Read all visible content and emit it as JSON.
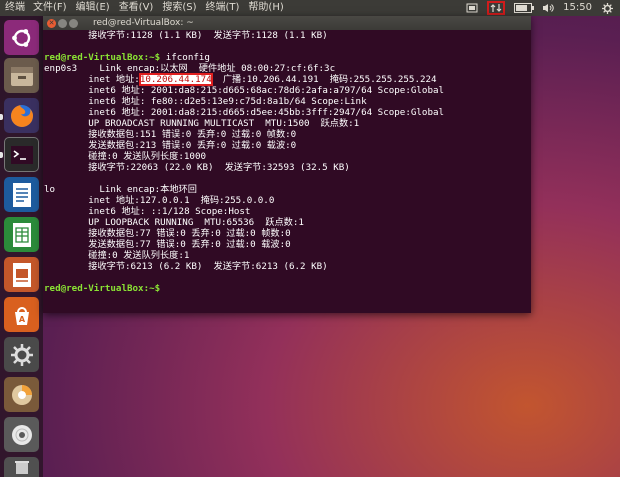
{
  "topbar": {
    "app_name": "终端",
    "menu": [
      "文件(F)",
      "编辑(E)",
      "查看(V)",
      "搜索(S)",
      "终端(T)",
      "帮助(H)"
    ],
    "clock": "15:50",
    "battery_level": 0.8,
    "highlight_color": "#d21c1c"
  },
  "launcher": {
    "icons": [
      "ubuntu-dash-icon",
      "files-icon",
      "firefox-icon",
      "terminal-icon",
      "writer-icon",
      "calc-icon",
      "impress-icon",
      "software-center-icon",
      "settings-icon",
      "disk-icon",
      "dvd-icon",
      "trash-icon"
    ]
  },
  "terminal": {
    "title": "red@red-VirtualBox: ~",
    "lines": {
      "l0": "        接收字节:1128 (1.1 KB)  发送字节:1128 (1.1 KB)",
      "l1": "",
      "l2_prompt": "red@red-VirtualBox:~$",
      "l2_cmd": " ifconfig",
      "l3": "enp0s3    Link encap:以太网  硬件地址 08:00:27:cf:6f:3c",
      "l4_pre": "        inet 地址:",
      "l4_ip": "10.206.44.174",
      "l4_post": "  广播:10.206.44.191  掩码:255.255.255.224",
      "l5": "        inet6 地址: 2001:da8:215:d665:68ac:78d6:2afa:a797/64 Scope:Global",
      "l6": "        inet6 地址: fe80::d2e5:13e9:c75d:8a1b/64 Scope:Link",
      "l7": "        inet6 地址: 2001:da8:215:d665:d5ee:45bb:3fff:2947/64 Scope:Global",
      "l8": "        UP BROADCAST RUNNING MULTICAST  MTU:1500  跃点数:1",
      "l9": "        接收数据包:151 错误:0 丢弃:0 过载:0 帧数:0",
      "l10": "        发送数据包:213 错误:0 丢弃:0 过载:0 载波:0",
      "l11": "        碰撞:0 发送队列长度:1000",
      "l12": "        接收字节:22063 (22.0 KB)  发送字节:32593 (32.5 KB)",
      "l13": "",
      "l14": "lo        Link encap:本地环回",
      "l15": "        inet 地址:127.0.0.1  掩码:255.0.0.0",
      "l16": "        inet6 地址: ::1/128 Scope:Host",
      "l17": "        UP LOOPBACK RUNNING  MTU:65536  跃点数:1",
      "l18": "        接收数据包:77 错误:0 丢弃:0 过载:0 帧数:0",
      "l19": "        发送数据包:77 错误:0 丢弃:0 过载:0 载波:0",
      "l20": "        碰撞:0 发送队列长度:1",
      "l21": "        接收字节:6213 (6.2 KB)  发送字节:6213 (6.2 KB)",
      "l22": "",
      "l23_prompt": "red@red-VirtualBox:~$",
      "l23_cmd": " "
    }
  }
}
